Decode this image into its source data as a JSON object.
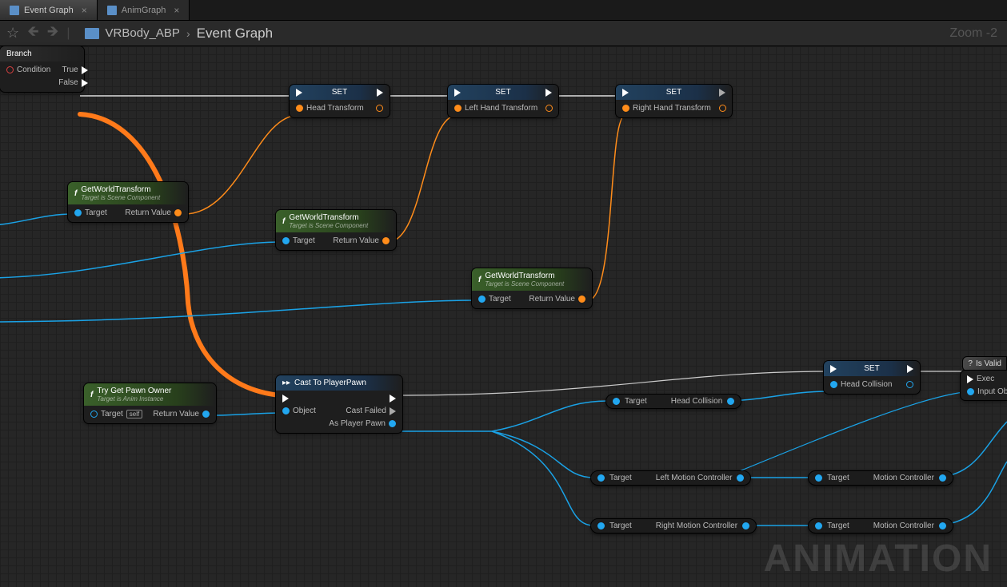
{
  "tabs": [
    {
      "label": "Event Graph",
      "active": true
    },
    {
      "label": "AnimGraph",
      "active": false
    }
  ],
  "breadcrumb": {
    "root": "VRBody_ABP",
    "current": "Event Graph"
  },
  "zoom": "Zoom -2",
  "watermark": "ANIMATION",
  "branch": {
    "title": "Branch",
    "true": "True",
    "false": "False",
    "condition": "Condition"
  },
  "setNodes": [
    {
      "title": "SET",
      "var": "Head Transform"
    },
    {
      "title": "SET",
      "var": "Left Hand Transform"
    },
    {
      "title": "SET",
      "var": "Right Hand Transform"
    }
  ],
  "getWorld": {
    "title": "GetWorldTransform",
    "sub": "Target is Scene Component",
    "target": "Target",
    "ret": "Return Value"
  },
  "tryGetPawn": {
    "title": "Try Get Pawn Owner",
    "sub": "Target is Anim Instance",
    "target": "Target",
    "self": "self",
    "ret": "Return Value"
  },
  "cast": {
    "title": "Cast To PlayerPawn",
    "object": "Object",
    "failed": "Cast Failed",
    "as": "As Player Pawn"
  },
  "setHeadColl": {
    "title": "SET",
    "var": "Head Collision"
  },
  "varNodes": {
    "headCollision": {
      "in": "Target",
      "out": "Head Collision"
    },
    "leftMotion": {
      "in": "Target",
      "out": "Left Motion Controller"
    },
    "rightMotion": {
      "in": "Target",
      "out": "Right Motion Controller"
    },
    "motionCtrl": {
      "in": "Target",
      "out": "Motion Controller"
    }
  },
  "isValid": {
    "title": "Is Valid",
    "exec": "Exec",
    "input": "Input Ob"
  }
}
